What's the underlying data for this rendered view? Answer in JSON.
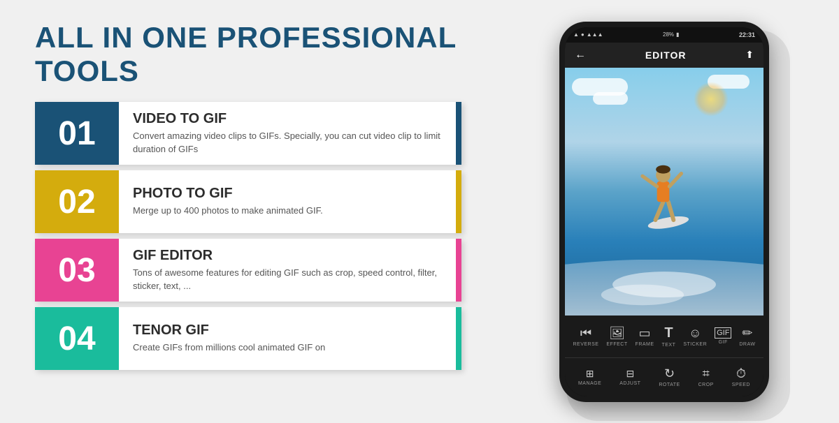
{
  "header": {
    "title": "ALL IN ONE PROFESSIONAL TOOLS"
  },
  "features": [
    {
      "number": "01",
      "title": "VIDEO TO GIF",
      "description": "Convert amazing video clips to GIFs. Specially, you can cut video clip to limit duration of GIFs",
      "color_class": "item-1"
    },
    {
      "number": "02",
      "title": "PHOTO TO GIF",
      "description": "Merge up to 400 photos to make animated GIF.",
      "color_class": "item-2"
    },
    {
      "number": "03",
      "title": "GIF EDITOR",
      "description": "Tons of awesome features for editing GIF such as  crop, speed control, filter, sticker, text, ...",
      "color_class": "item-3"
    },
    {
      "number": "04",
      "title": "TENOR GIF",
      "description": "Create GIFs from millions cool animated GIF on",
      "color_class": "item-4"
    }
  ],
  "phone": {
    "status": {
      "time": "22:31",
      "battery": "28%",
      "signal": "▲▲▲"
    },
    "header": {
      "back": "←",
      "title": "EDITOR",
      "upload": "⬆"
    },
    "toolbar_top": [
      {
        "icon": "⏪",
        "label": "REVERSE"
      },
      {
        "icon": "✦",
        "label": "EFFECT"
      },
      {
        "icon": "▭",
        "label": "FRAME"
      },
      {
        "icon": "T",
        "label": "TEXT"
      },
      {
        "icon": "☺",
        "label": "STICKER"
      },
      {
        "icon": "GIF",
        "label": "GIF"
      },
      {
        "icon": "✏",
        "label": "DRAW"
      }
    ],
    "toolbar_bottom": [
      {
        "icon": "⋮⋮",
        "label": "MANAGE"
      },
      {
        "icon": "≡≡",
        "label": "ADJUST"
      },
      {
        "icon": "↻",
        "label": "ROTATE"
      },
      {
        "icon": "⌗",
        "label": "CROP"
      },
      {
        "icon": "⏱",
        "label": "SPEED"
      }
    ]
  }
}
